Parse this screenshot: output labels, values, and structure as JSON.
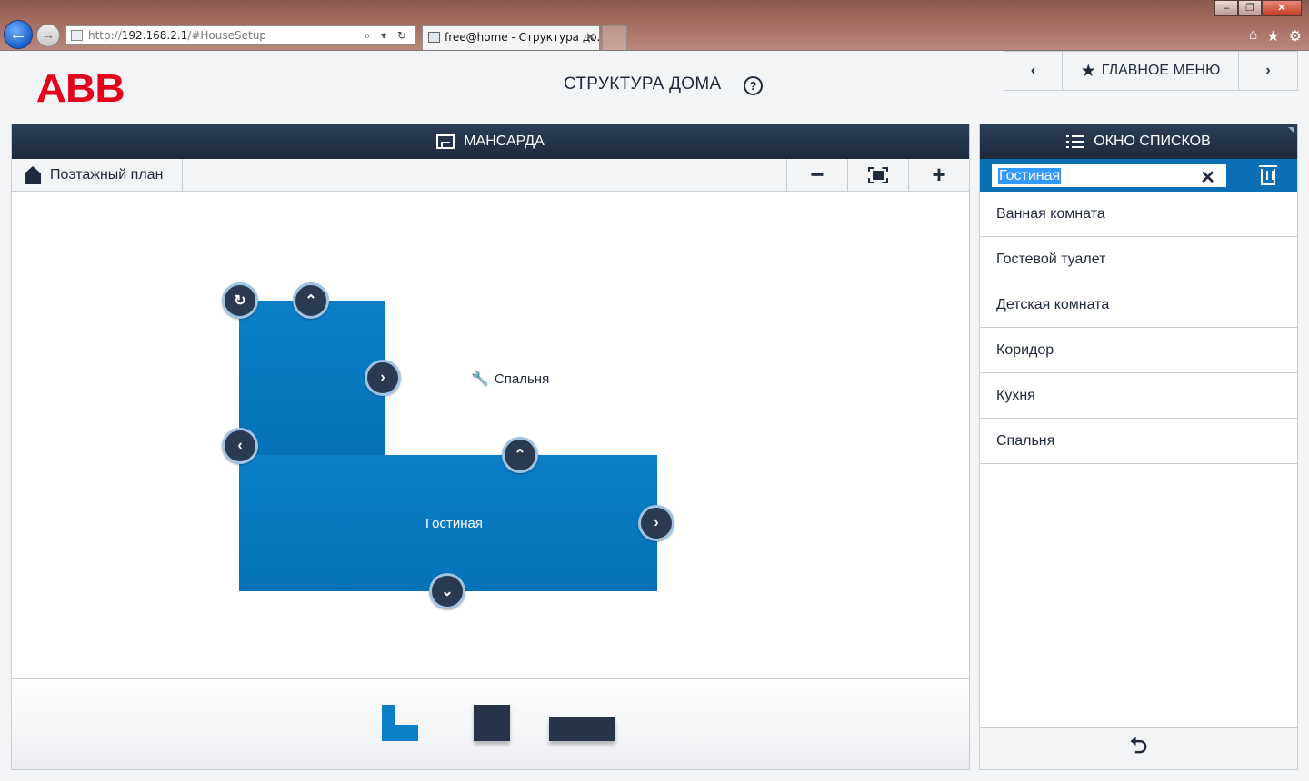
{
  "browser": {
    "url_prefix": "http://",
    "url_host": "192.168.2.1",
    "url_path": "/#HouseSetup",
    "tab_title": "free@home - Структура до...",
    "win_min": "–",
    "win_max": "❐",
    "win_close": "✕",
    "back_glyph": "←",
    "forward_glyph": "→",
    "addr_tools": "⌕ ▾ ↻",
    "tab_close": "✕",
    "icons": [
      "home-icon",
      "favorites-star-icon",
      "settings-gear-icon"
    ],
    "home_glyph": "⌂",
    "star_glyph": "★",
    "gear_glyph": "⚙"
  },
  "header": {
    "logo": "ABB",
    "title": "СТРУКТУРА ДОМА",
    "help": "?",
    "nav_prev": "‹",
    "nav_next": "›",
    "main_menu_star": "★",
    "main_menu": "ГЛАВНОЕ МЕНЮ"
  },
  "floor": {
    "name": "МАНСАРДА",
    "plan_label": "Поэтажный план",
    "zoom_out": "−",
    "zoom_in": "+"
  },
  "rooms": {
    "bedroom": "Спальня",
    "living": "Гостиная",
    "wrench": "🔧"
  },
  "handles": {
    "rotate": "↻",
    "up": "⌃",
    "right": "›",
    "left": "‹",
    "down": "⌄"
  },
  "list_window": {
    "title": "ОКНО СПИСКОВ",
    "search_value": "Гостиная",
    "clear": "✕",
    "items": [
      "Ванная комната",
      "Гостевой туалет",
      "Детская комната",
      "Коридор",
      "Кухня",
      "Спальня"
    ],
    "back": "⮌"
  },
  "colors": {
    "accent_blue": "#0a7ec6",
    "header_dark": "#1c2a3e",
    "abb_red": "#e2001a"
  }
}
